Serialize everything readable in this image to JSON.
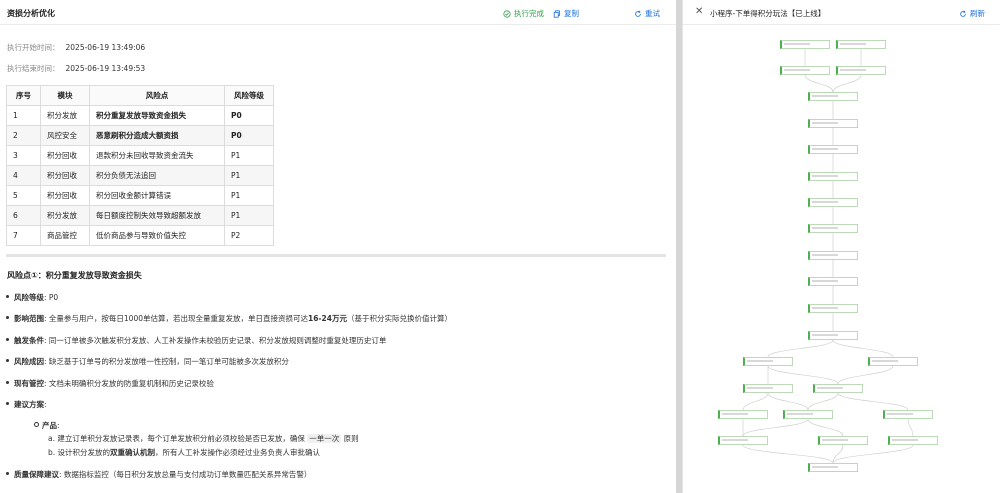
{
  "left": {
    "title": "资损分析优化",
    "status_done": "执行完成",
    "copy_label": "复制",
    "retry_label": "重试",
    "start_label": "执行开始时间：",
    "start_value": "2025-06-19 13:49:06",
    "end_label": "执行结束时间：",
    "end_value": "2025-06-19 13:49:53",
    "table": {
      "headers": [
        "序号",
        "模块",
        "风险点",
        "风险等级"
      ],
      "rows": [
        {
          "no": "1",
          "module": "积分发放",
          "risk": "积分重复发放导致资金损失",
          "level": "P0",
          "bold": true
        },
        {
          "no": "2",
          "module": "风控安全",
          "risk": "恶意刷积分造成大额资损",
          "level": "P0",
          "bold": true
        },
        {
          "no": "3",
          "module": "积分回收",
          "risk": "退款积分未回收导致资金流失",
          "level": "P1",
          "bold": false
        },
        {
          "no": "4",
          "module": "积分回收",
          "risk": "积分负债无法追回",
          "level": "P1",
          "bold": false
        },
        {
          "no": "5",
          "module": "积分回收",
          "risk": "积分回收金额计算错误",
          "level": "P1",
          "bold": false
        },
        {
          "no": "6",
          "module": "积分发放",
          "risk": "每日额度控制失效导致超额发放",
          "level": "P1",
          "bold": false
        },
        {
          "no": "7",
          "module": "商品管控",
          "risk": "低价商品参与导致价值失控",
          "level": "P2",
          "bold": false
        }
      ]
    },
    "risk_section": {
      "title": "风险点①：积分重复发放导致资金损失",
      "level_label": "风险等级",
      "level_value": ": P0",
      "impact_label": "影响范围",
      "impact_text": ": 全量参与用户，按每日1000单估算，若出现全量重复发放，单日直接资损可达",
      "impact_amount": "16-24万元",
      "impact_suffix": "（基于积分实际兑换价值计算）",
      "trigger_label": "触发条件",
      "trigger_text": ": 同一订单被多次触发积分发放、人工补发操作未校验历史记录、积分发放规则调整时重复处理历史订单",
      "cause_label": "风险成因",
      "cause_text": ": 缺乏基于订单号的积分发放唯一性控制，同一笔订单可能被多次发放积分",
      "control_label": "现有管控",
      "control_text": ": 文档未明确积分发放的防重复机制和历史记录校验",
      "suggest_label": "建议方案",
      "suggest_suffix": ":",
      "product_label": "产品",
      "product_suffix": ":",
      "item_a_prefix": "a. 建立订单积分发放记录表，每个订单发放积分前必须校验是否已发放，确保",
      "item_a_code": "一单一次",
      "item_a_suffix": "原则",
      "item_b_prefix": "b. 设计积分发放的",
      "item_b_bold": "双重确认机制",
      "item_b_suffix": "，所有人工补发操作必须经过业务负责人审批确认",
      "quality_label": "质量保障建议",
      "quality_text": ": 数据指标监控（每日积分发放总量与支付成功订单数量匹配关系异常告警）"
    }
  },
  "right": {
    "title": "小程序-下单得积分玩法【已上线】",
    "refresh_label": "刷新"
  },
  "colors": {
    "accent": "#1a6fe0",
    "success": "#2ea043",
    "node_border": "#4caf50"
  }
}
